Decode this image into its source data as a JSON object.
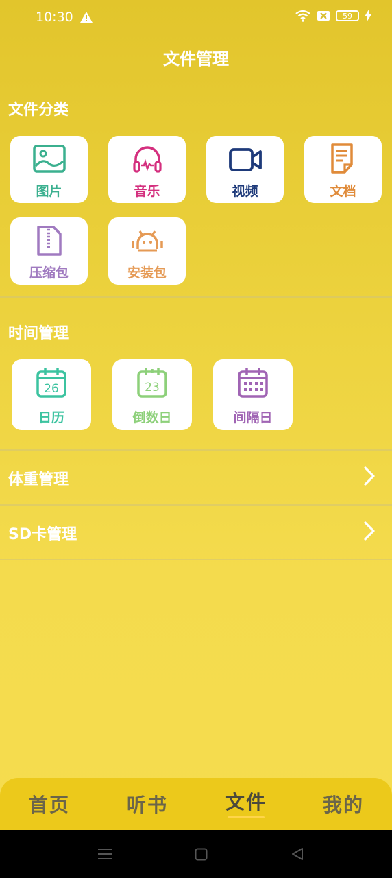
{
  "status_bar": {
    "time": "10:30",
    "battery": "59"
  },
  "header": {
    "title": "文件管理"
  },
  "file_category": {
    "title": "文件分类",
    "items": [
      {
        "label": "图片",
        "icon": "image-icon",
        "color": "#3bb08f"
      },
      {
        "label": "音乐",
        "icon": "headphones-icon",
        "color": "#d42f7e"
      },
      {
        "label": "视频",
        "icon": "video-camera-icon",
        "color": "#1e3a7a"
      },
      {
        "label": "文档",
        "icon": "document-icon",
        "color": "#e08b3a"
      },
      {
        "label": "压缩包",
        "icon": "zip-file-icon",
        "color": "#a07ac0"
      },
      {
        "label": "安装包",
        "icon": "android-icon",
        "color": "#e59a55"
      }
    ]
  },
  "time_management": {
    "title": "时间管理",
    "items": [
      {
        "label": "日历",
        "icon": "calendar-icon",
        "icon_text": "26",
        "color": "#3cc3a0"
      },
      {
        "label": "倒数日",
        "icon": "countdown-calendar-icon",
        "icon_text": "23",
        "color": "#8dd07a"
      },
      {
        "label": "间隔日",
        "icon": "interval-calendar-icon",
        "color": "#a064b4"
      }
    ]
  },
  "rows": [
    {
      "label": "体重管理"
    },
    {
      "label": "SD卡管理"
    }
  ],
  "bottom_nav": {
    "items": [
      {
        "label": "首页"
      },
      {
        "label": "听书"
      },
      {
        "label": "文件"
      },
      {
        "label": "我的"
      }
    ],
    "active_index": 2
  }
}
